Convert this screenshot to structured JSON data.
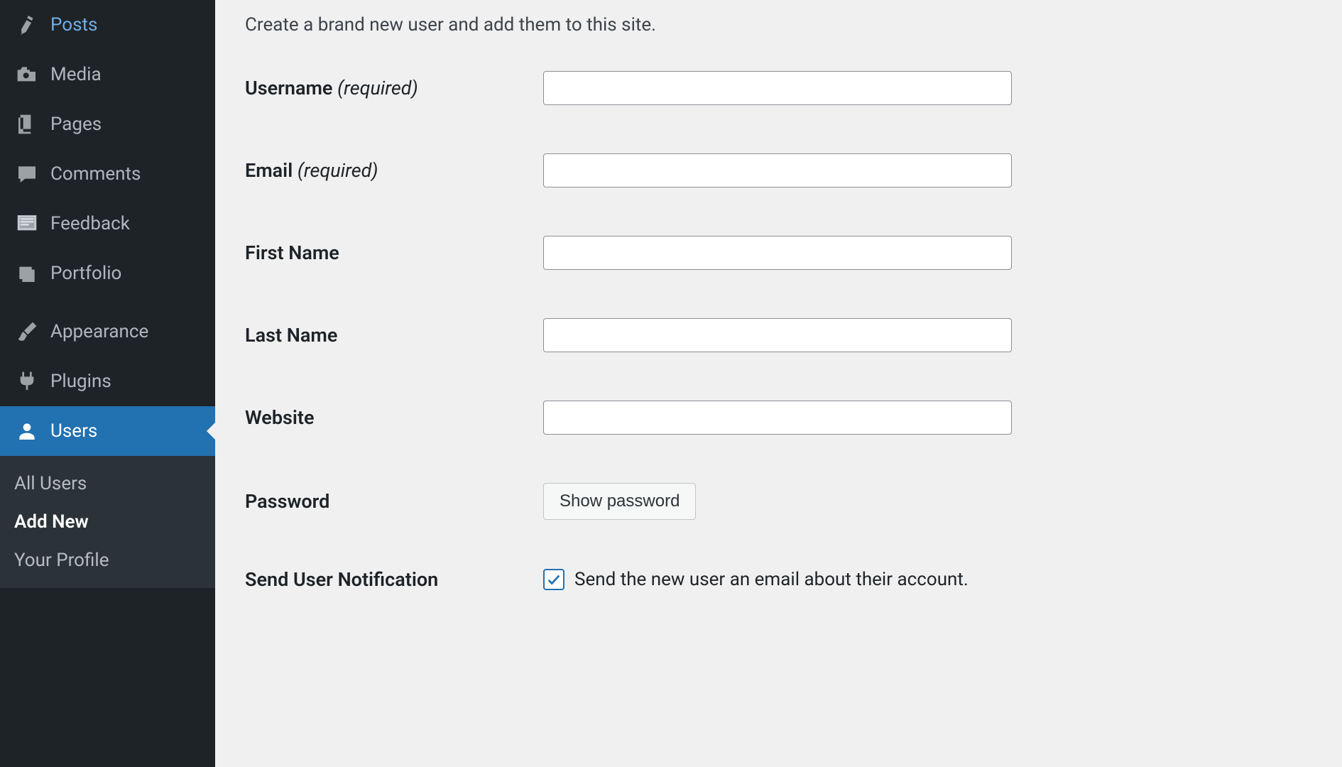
{
  "sidebar": {
    "items": [
      {
        "label": "Posts"
      },
      {
        "label": "Media"
      },
      {
        "label": "Pages"
      },
      {
        "label": "Comments"
      },
      {
        "label": "Feedback"
      },
      {
        "label": "Portfolio"
      },
      {
        "label": "Appearance"
      },
      {
        "label": "Plugins"
      },
      {
        "label": "Users"
      }
    ],
    "submenu": {
      "all_users": "All Users",
      "add_new": "Add New",
      "your_profile": "Your Profile"
    }
  },
  "main": {
    "subtitle": "Create a brand new user and add them to this site.",
    "fields": {
      "username": {
        "label": "Username ",
        "required": "(required)",
        "value": ""
      },
      "email": {
        "label": "Email ",
        "required": "(required)",
        "value": ""
      },
      "first_name": {
        "label": "First Name",
        "value": ""
      },
      "last_name": {
        "label": "Last Name",
        "value": ""
      },
      "website": {
        "label": "Website",
        "value": ""
      },
      "password": {
        "label": "Password",
        "button": "Show password"
      },
      "notification": {
        "label": "Send User Notification",
        "checkbox_label": "Send the new user an email about their account.",
        "checked": true
      }
    }
  }
}
